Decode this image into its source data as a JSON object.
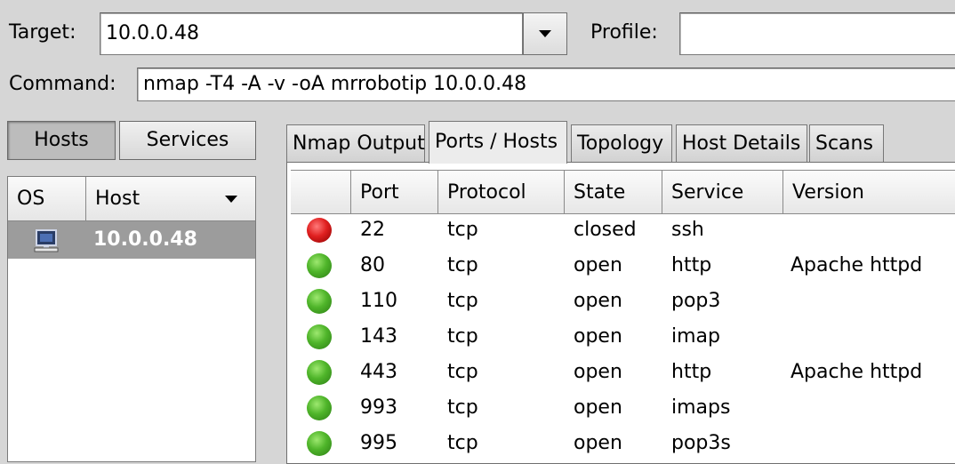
{
  "toolbar": {
    "target_label": "Target:",
    "target_value": "10.0.0.48",
    "profile_label": "Profile:",
    "profile_value": "",
    "command_label": "Command:",
    "command_value": "nmap -T4 -A -v -oA mrrobotip 10.0.0.48"
  },
  "sidebar": {
    "toggle_hosts": "Hosts",
    "toggle_services": "Services",
    "columns": {
      "os": "OS",
      "host": "Host"
    },
    "hosts": [
      {
        "host": "10.0.0.48",
        "os_icon": "computer-icon"
      }
    ]
  },
  "tabs": [
    {
      "label": "Nmap Output"
    },
    {
      "label": "Ports / Hosts"
    },
    {
      "label": "Topology"
    },
    {
      "label": "Host Details"
    },
    {
      "label": "Scans"
    }
  ],
  "ports_table": {
    "columns": {
      "status": "",
      "port": "Port",
      "protocol": "Protocol",
      "state": "State",
      "service": "Service",
      "version": "Version"
    },
    "rows": [
      {
        "status": "red",
        "port": "22",
        "protocol": "tcp",
        "state": "closed",
        "service": "ssh",
        "version": ""
      },
      {
        "status": "green",
        "port": "80",
        "protocol": "tcp",
        "state": "open",
        "service": "http",
        "version": "Apache httpd"
      },
      {
        "status": "green",
        "port": "110",
        "protocol": "tcp",
        "state": "open",
        "service": "pop3",
        "version": ""
      },
      {
        "status": "green",
        "port": "143",
        "protocol": "tcp",
        "state": "open",
        "service": "imap",
        "version": ""
      },
      {
        "status": "green",
        "port": "443",
        "protocol": "tcp",
        "state": "open",
        "service": "http",
        "version": "Apache httpd"
      },
      {
        "status": "green",
        "port": "993",
        "protocol": "tcp",
        "state": "open",
        "service": "imaps",
        "version": ""
      },
      {
        "status": "green",
        "port": "995",
        "protocol": "tcp",
        "state": "open",
        "service": "pop3s",
        "version": ""
      }
    ]
  },
  "colors": {
    "selected_row": "#9c9c9c",
    "status_open": "#4fb52a",
    "status_closed": "#e02020"
  }
}
